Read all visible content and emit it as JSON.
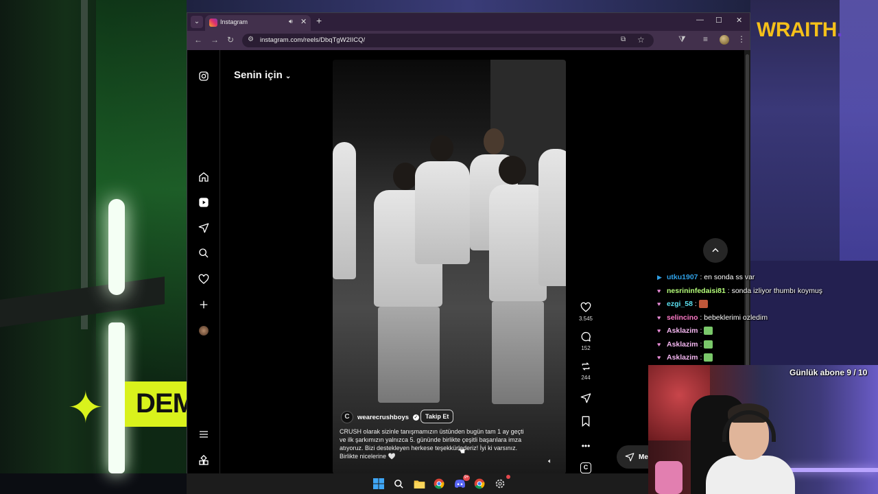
{
  "overlay": {
    "brand": "WRAITH",
    "banner_text": "DEMİ",
    "subscriber_goal": "Günlük abone 9 / 10"
  },
  "browser": {
    "tab_title": "Instagram",
    "url": "instagram.com/reels/DbqTgW2IICQ/"
  },
  "instagram": {
    "feed_title": "Senin için",
    "nav": [
      "instagram-logo",
      "home",
      "reels",
      "messages",
      "search",
      "notifications",
      "create",
      "profile",
      "more",
      "also-from-meta"
    ],
    "reel": {
      "username": "wearecrushboys",
      "verified": true,
      "follow_label": "Takip Et",
      "caption": "CRUSH olarak sizinle tanışmamızın üstünden bugün tam 1 ay geçti ve ilk şarkımızın yalnızca 5. gününde birlikte çeşitli başarılara imza atıyoruz. Bizi destekleyen herkese teşekkürlederiz! İyi ki varsınız. Birlikte nicelerine 🤍",
      "likes": "3.545",
      "comments": "152",
      "reposts": "244"
    },
    "messages_label": "Mes"
  },
  "chat": [
    {
      "badge": "▶",
      "badge_color": "#2fa0e6",
      "user": "utku1907",
      "user_color": "#2fa0e6",
      "message": "en sonda ss var",
      "emote": null
    },
    {
      "badge": "♥",
      "badge_color": "#e88bd6",
      "user": "nesrininfedaisi81",
      "user_color": "#b6ff7a",
      "message": "sonda izliyor thumbı koymuş",
      "emote": null
    },
    {
      "badge": "♥",
      "badge_color": "#e88bd6",
      "user": "ezgi_58",
      "user_color": "#5be0f0",
      "message": "",
      "emote": "#c0583a"
    },
    {
      "badge": "♥",
      "badge_color": "#e88bd6",
      "user": "selincino",
      "user_color": "#ff7ac8",
      "message": "bebeklerimi ozledim",
      "emote": null
    },
    {
      "badge": "♥",
      "badge_color": "#e88bd6",
      "user": "Asklazim",
      "user_color": "#f4b6f0",
      "message": "",
      "emote": "#7ac86a"
    },
    {
      "badge": "♥",
      "badge_color": "#e88bd6",
      "user": "Asklazim",
      "user_color": "#f4b6f0",
      "message": "",
      "emote": "#7ac86a"
    },
    {
      "badge": "♥",
      "badge_color": "#e88bd6",
      "user": "Asklazim",
      "user_color": "#f4b6f0",
      "message": "",
      "emote": "#7ac86a"
    }
  ],
  "taskbar": {
    "icons": [
      "windows-start",
      "search",
      "file-explorer",
      "chrome",
      "discord",
      "chrome-profile",
      "settings"
    ],
    "discord_badge": "9+"
  }
}
